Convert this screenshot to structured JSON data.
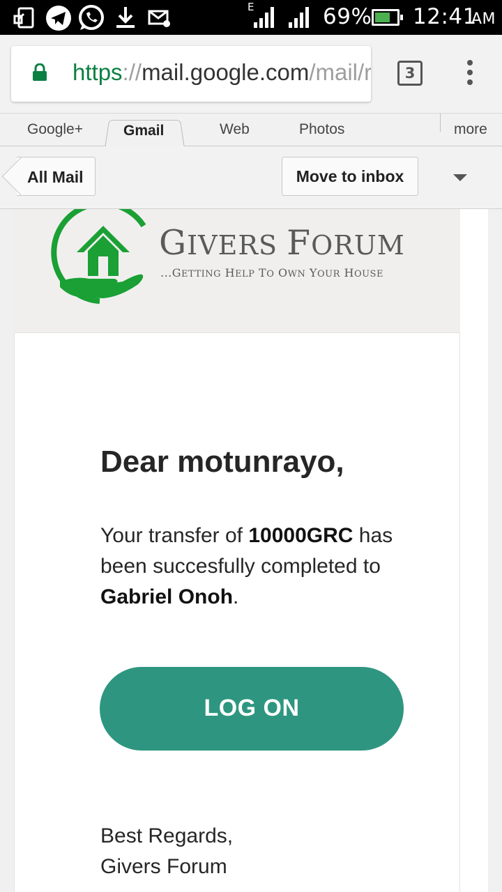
{
  "status_bar": {
    "network_type": "E",
    "battery": "69%",
    "time": "12:41",
    "ampm": "AM",
    "icons": [
      "screen-mirror-icon",
      "telegram-icon",
      "whatsapp-icon",
      "download-icon",
      "mail-muted-icon",
      "signal-icon",
      "signal-icon",
      "battery-icon"
    ],
    "battery_level": 0.69
  },
  "browser": {
    "url_scheme": "https",
    "url_sep": "://",
    "url_host": "mail.google.com",
    "url_path": "/mail/r",
    "tab_count": "3"
  },
  "google_bar": {
    "items": [
      "Google+",
      "Gmail",
      "Web",
      "Photos",
      "more"
    ],
    "active": "Gmail"
  },
  "toolbar": {
    "back_label": "All Mail",
    "move_label": "Move to inbox"
  },
  "email": {
    "brand": "Givers Forum",
    "tagline": "...Getting Help To Own Your House",
    "greeting": "Dear motunrayo,",
    "body_1": "Your transfer of ",
    "amount": "10000GRC",
    "body_2": " has been succesfully completed to ",
    "recipient": "Gabriel Onoh",
    "body_3": ".",
    "button_label": "LOG ON",
    "regards_1": "Best Regards,",
    "regards_2": "Givers Forum"
  },
  "colors": {
    "button": "#2e9680",
    "logo_green": "#1aa034",
    "url_green": "#0b8043"
  }
}
